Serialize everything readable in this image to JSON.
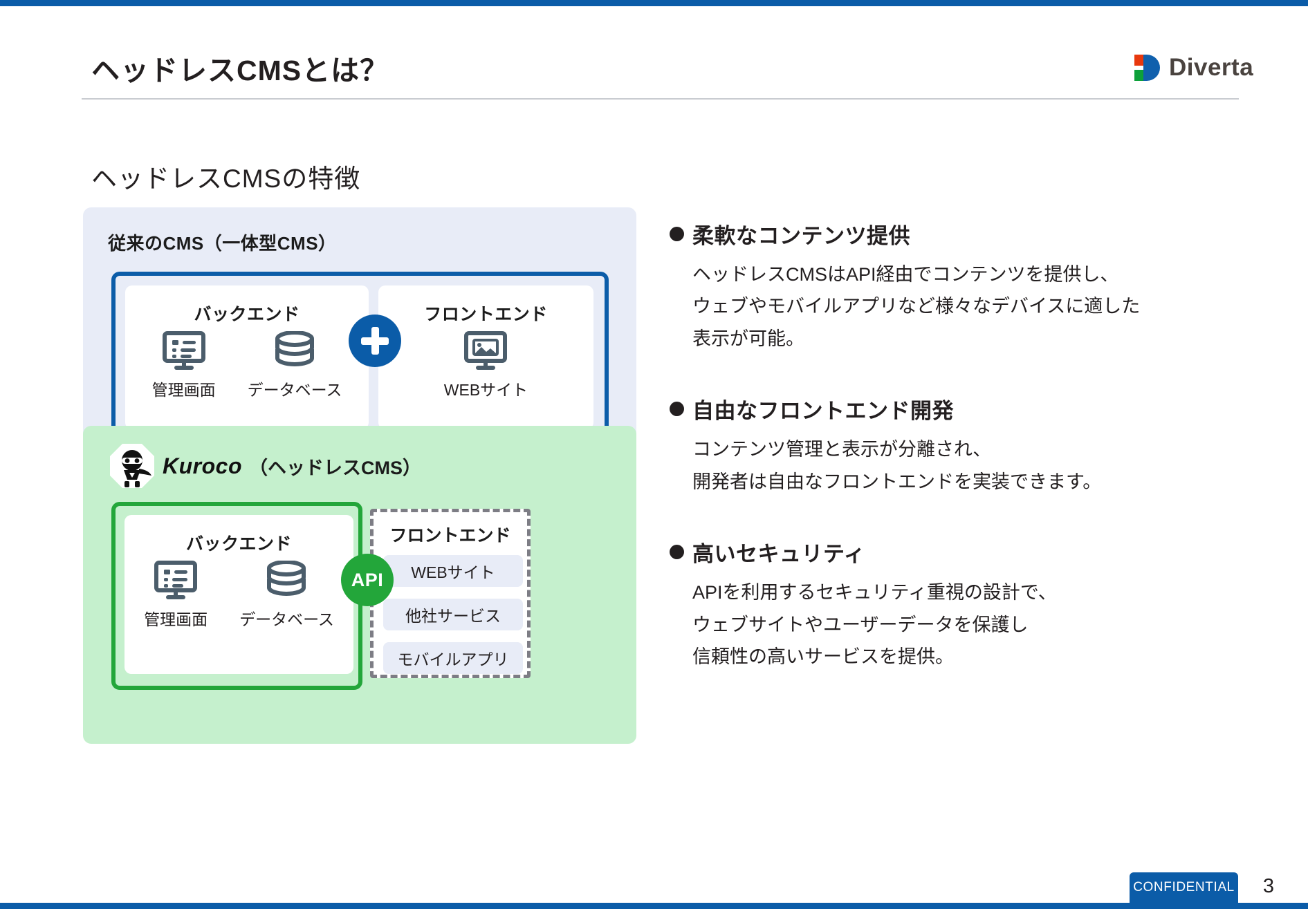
{
  "header": {
    "title": "ヘッドレスCMSとは？",
    "logo_text": "Diverta"
  },
  "section": {
    "heading": "ヘッドレスCMSの特徴"
  },
  "diagram": {
    "traditional": {
      "panel_title": "従来のCMS（一体型CMS）",
      "backend_label": "バックエンド",
      "frontend_label": "フロントエンド",
      "backend_items": [
        "管理画面",
        "データベース"
      ],
      "frontend_items": [
        "WEBサイト"
      ],
      "plus_symbol": "+"
    },
    "headless": {
      "brand": "Kuroco",
      "brand_suffix": "（ヘッドレスCMS）",
      "backend_label": "バックエンド",
      "frontend_label": "フロントエンド",
      "backend_items": [
        "管理画面",
        "データベース"
      ],
      "frontend_items": [
        "WEBサイト",
        "他社サービス",
        "モバイルアプリ"
      ],
      "api_label": "API"
    }
  },
  "features": [
    {
      "title": "柔軟なコンテンツ提供",
      "lines": [
        "ヘッドレスCMSはAPI経由でコンテンツを提供し、",
        "ウェブやモバイルアプリなど様々なデバイスに適した",
        "表示が可能。"
      ]
    },
    {
      "title": "自由なフロントエンド開発",
      "lines": [
        "コンテンツ管理と表示が分離され、",
        "開発者は自由なフロントエンドを実装できます。"
      ]
    },
    {
      "title": "高いセキュリティ",
      "lines": [
        "APIを利用するセキュリティ重視の設計で、",
        "ウェブサイトやユーザーデータを保護し",
        "信頼性の高いサービスを提供。"
      ]
    }
  ],
  "footer": {
    "confidential": "CONFIDENTIAL",
    "page_number": "3"
  },
  "colors": {
    "brand_blue": "#0b5ca8",
    "brand_green": "#23a63a",
    "panel_blue_bg": "#e8ecf7",
    "panel_green_bg": "#c5f0cd",
    "icon_slate": "#4b5d6b",
    "arrow_grey": "#84868f"
  }
}
